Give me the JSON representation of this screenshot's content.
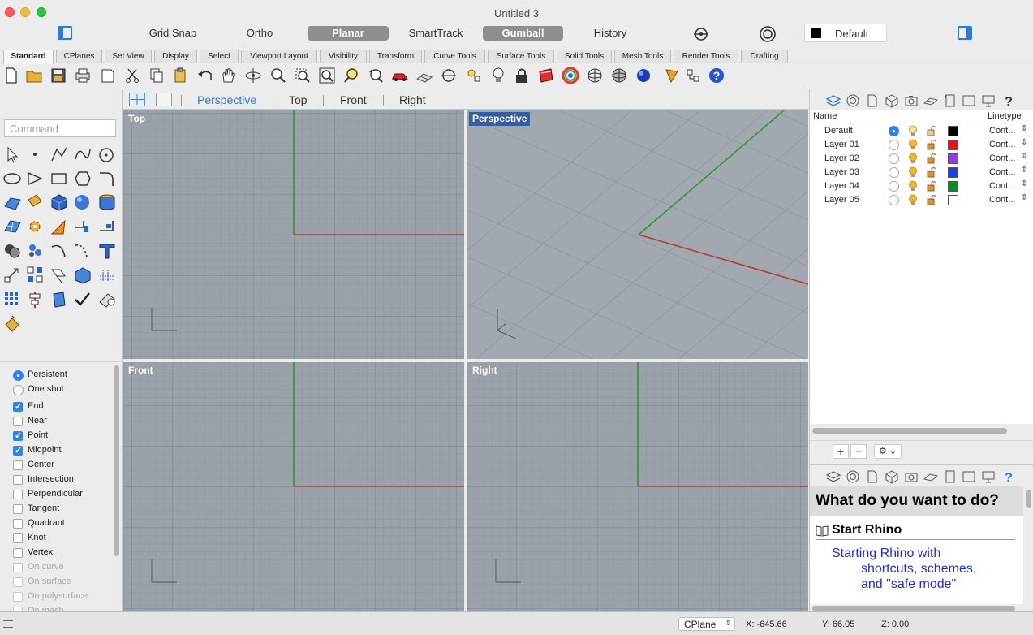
{
  "window": {
    "title": "Untitled 3"
  },
  "topbar": {
    "grid_snap": "Grid Snap",
    "ortho": "Ortho",
    "planar": "Planar",
    "smarttrack": "SmartTrack",
    "gumball": "Gumball",
    "history": "History",
    "current_layer": "Default"
  },
  "tabs": [
    "Standard",
    "CPlanes",
    "Set View",
    "Display",
    "Select",
    "Viewport Layout",
    "Visibility",
    "Transform",
    "Curve Tools",
    "Surface Tools",
    "Solid Tools",
    "Mesh Tools",
    "Render Tools",
    "Drafting"
  ],
  "command": {
    "placeholder": "Command"
  },
  "snaps": {
    "persistent": "Persistent",
    "one_shot": "One shot",
    "items": [
      {
        "label": "End",
        "checked": true
      },
      {
        "label": "Near",
        "checked": false
      },
      {
        "label": "Point",
        "checked": true
      },
      {
        "label": "Midpoint",
        "checked": true
      },
      {
        "label": "Center",
        "checked": false
      },
      {
        "label": "Intersection",
        "checked": false
      },
      {
        "label": "Perpendicular",
        "checked": false
      },
      {
        "label": "Tangent",
        "checked": false
      },
      {
        "label": "Quadrant",
        "checked": false
      },
      {
        "label": "Knot",
        "checked": false
      },
      {
        "label": "Vertex",
        "checked": false
      },
      {
        "label": "On curve",
        "checked": false
      },
      {
        "label": "On surface",
        "checked": false
      },
      {
        "label": "On polysurface",
        "checked": false
      },
      {
        "label": "On mesh",
        "checked": false
      }
    ]
  },
  "viewport_tabs": {
    "perspective": "Perspective",
    "top": "Top",
    "front": "Front",
    "right": "Right"
  },
  "viewports": {
    "top": "Top",
    "perspective": "Perspective",
    "front": "Front",
    "right": "Right"
  },
  "layers": {
    "name_header": "Name",
    "linetype_header": "Linetype",
    "rows": [
      {
        "name": "Default",
        "color": "#000000",
        "linetype": "Cont...",
        "current": true
      },
      {
        "name": "Layer 01",
        "color": "#ee1111",
        "linetype": "Cont...",
        "current": false
      },
      {
        "name": "Layer 02",
        "color": "#8a3ee0",
        "linetype": "Cont...",
        "current": false
      },
      {
        "name": "Layer 03",
        "color": "#1b3ff0",
        "linetype": "Cont...",
        "current": false
      },
      {
        "name": "Layer 04",
        "color": "#0f8a2a",
        "linetype": "Cont...",
        "current": false
      },
      {
        "name": "Layer 05",
        "color": "#ffffff",
        "linetype": "Cont...",
        "current": false
      }
    ]
  },
  "help": {
    "question": "What do you want to do?",
    "heading": "Start Rhino",
    "link_line1": "Starting Rhino with",
    "link_line2": "shortcuts, schemes,",
    "link_line3": "and \"safe mode\""
  },
  "status": {
    "cplane": "CPlane",
    "x": "X: -645.66",
    "y": "Y: 66.05",
    "z": "Z: 0.00"
  },
  "colors": {
    "accent": "#2d83f0",
    "viewport_bg": "#9aa1a9",
    "x_axis": "#b33a3a",
    "y_axis": "#2e9a2e"
  }
}
